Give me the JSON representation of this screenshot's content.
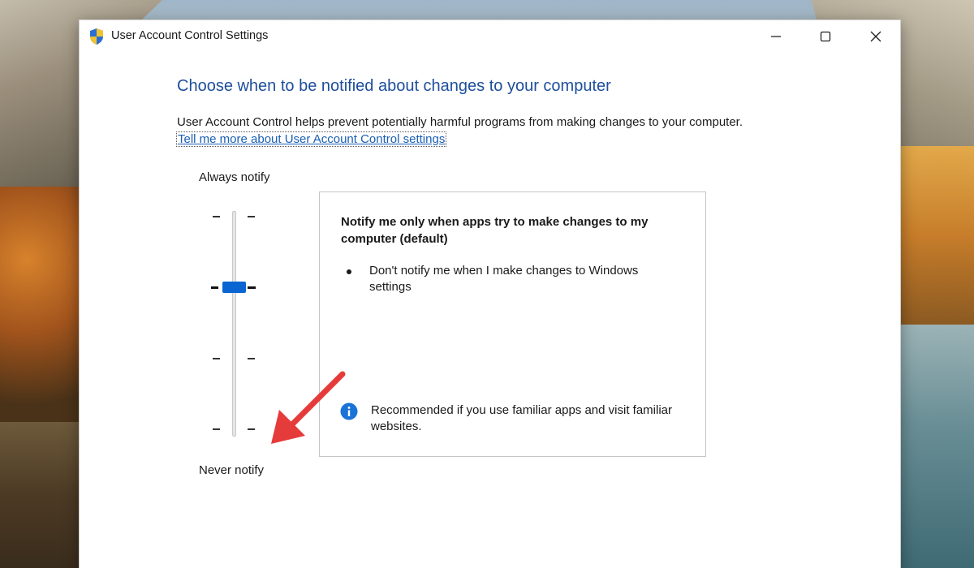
{
  "window": {
    "title": "User Account Control Settings",
    "minimize_icon": "minimize-icon",
    "maximize_icon": "maximize-icon",
    "close_icon": "close-icon"
  },
  "content": {
    "heading": "Choose when to be notified about changes to your computer",
    "description": "User Account Control helps prevent potentially harmful programs from making changes to your computer.",
    "learn_more_link": "Tell me more about User Account Control settings"
  },
  "slider": {
    "top_label": "Always notify",
    "bottom_label": "Never notify",
    "levels": 4,
    "selected_level": 3
  },
  "info_box": {
    "title": "Notify me only when apps try to make changes to my computer (default)",
    "bullet": "Don't notify me when I make changes to Windows settings",
    "recommendation": "Recommended if you use familiar apps and visit familiar websites."
  },
  "colors": {
    "heading": "#1e4e9b",
    "link": "#1a5fb4",
    "slider_thumb": "#0a64d2",
    "info_icon": "#1a73d8",
    "annotation_arrow": "#e63b3b"
  }
}
